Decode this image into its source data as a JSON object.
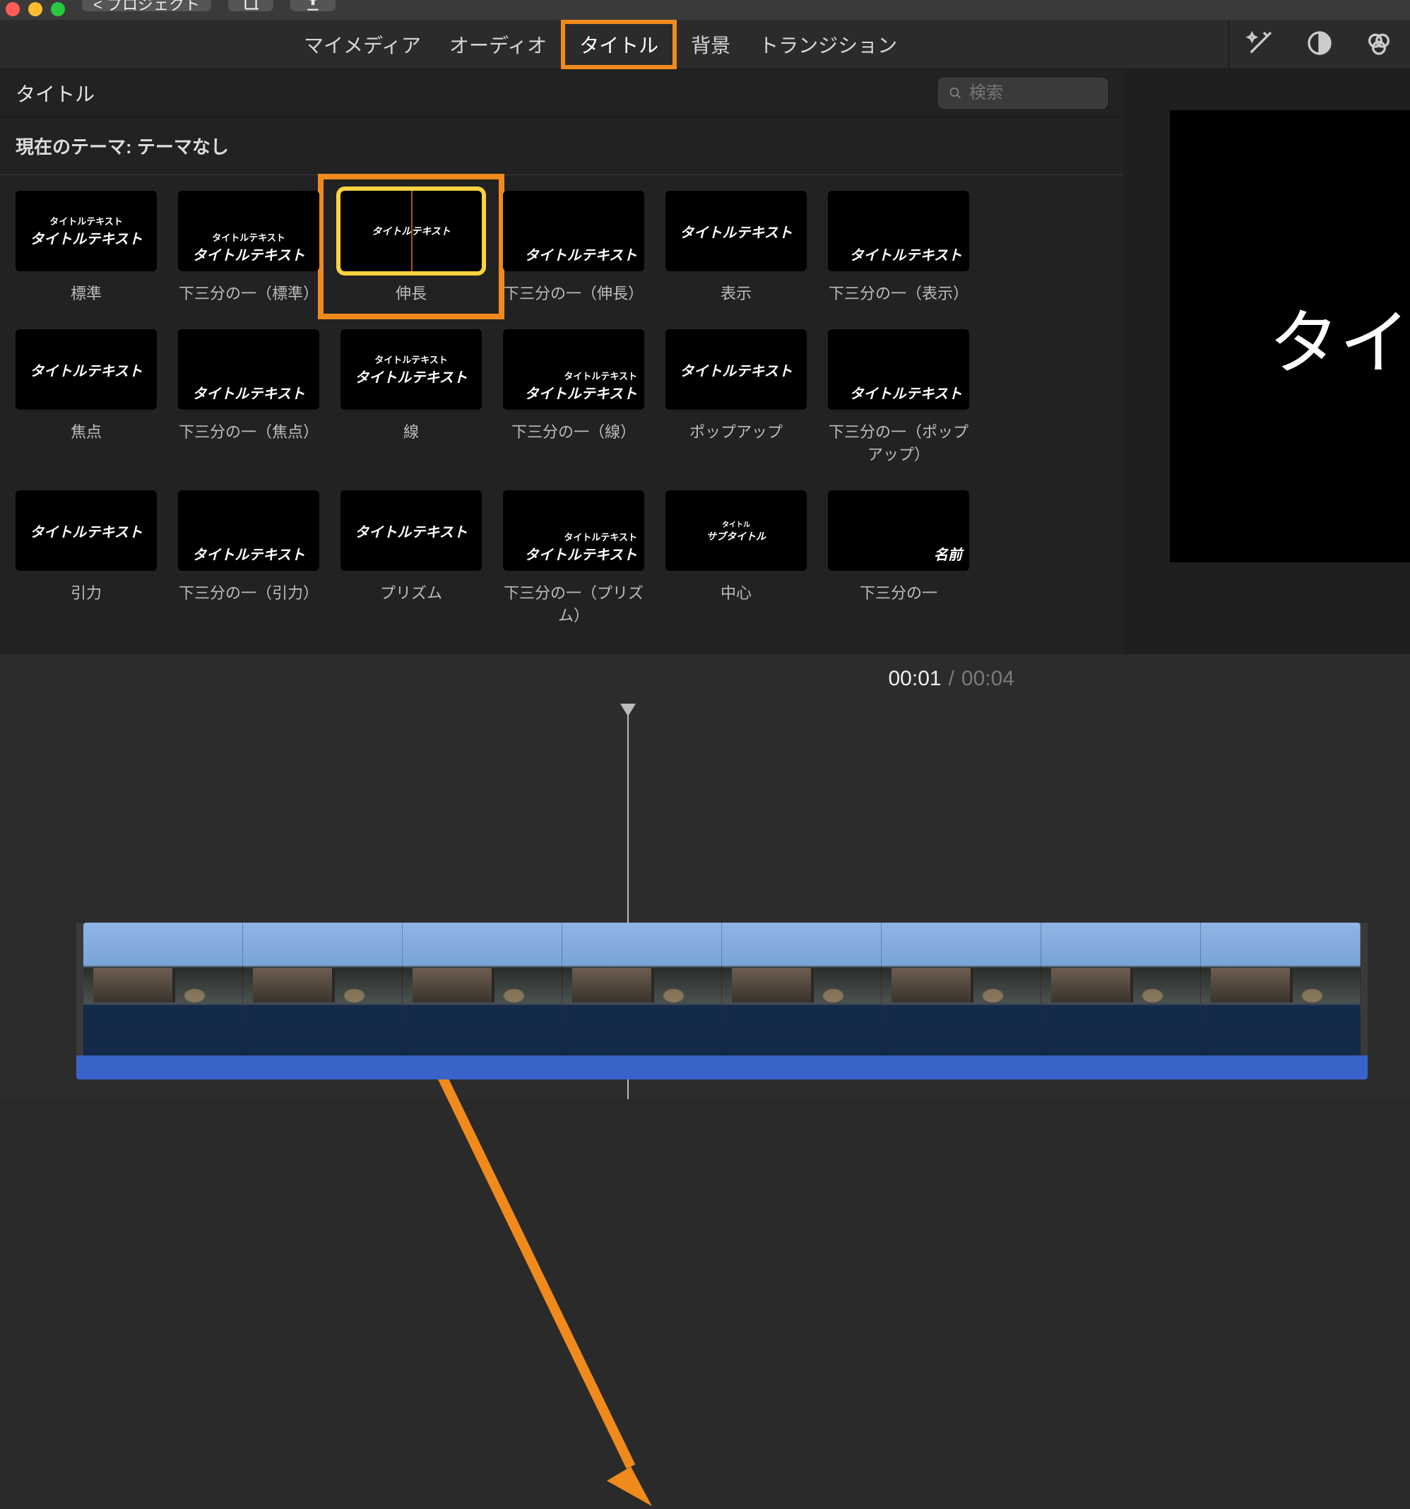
{
  "toolbar": {
    "project_button": "< プロジェクト"
  },
  "tabs": {
    "my_media": "マイメディア",
    "audio": "オーディオ",
    "titles": "タイトル",
    "backgrounds": "背景",
    "transitions": "トランジション"
  },
  "section_title": "タイトル",
  "search_placeholder": "検索",
  "theme_label": "現在のテーマ: テーマなし",
  "preview_word": "タイ",
  "time": {
    "current": "00:01",
    "total": "00:04"
  },
  "tiles": [
    {
      "label": "標準",
      "l1": "タイトルテキスト",
      "l2": "タイトルテキスト",
      "style": "center"
    },
    {
      "label": "下三分の一（標準）",
      "l1": "タイトルテキスト",
      "l2": "タイトルテキスト",
      "style": "lower"
    },
    {
      "label": "伸長",
      "l1": "",
      "l2": "タイトルテキスト",
      "style": "center-sm",
      "sel": true
    },
    {
      "label": "下三分の一（伸長）",
      "l1": "",
      "l2": "タイトルテキスト",
      "style": "lower-right"
    },
    {
      "label": "表示",
      "l1": "",
      "l2": "タイトルテキスト",
      "style": "center"
    },
    {
      "label": "下三分の一（表示）",
      "l1": "",
      "l2": "タイトルテキスト",
      "style": "lower-right"
    },
    {
      "label": "焦点",
      "l1": "",
      "l2": "タイトルテキスト",
      "style": "center"
    },
    {
      "label": "下三分の一（焦点）",
      "l1": "",
      "l2": "タイトルテキスト",
      "style": "lower"
    },
    {
      "label": "線",
      "l1": "タイトルテキスト",
      "l2": "タイトルテキスト",
      "style": "center"
    },
    {
      "label": "下三分の一（線）",
      "l1": "タイトルテキスト",
      "l2": "タイトルテキスト",
      "style": "lower-right"
    },
    {
      "label": "ポップアップ",
      "l1": "",
      "l2": "タイトルテキスト",
      "style": "center"
    },
    {
      "label": "下三分の一（ポップアップ）",
      "l1": "",
      "l2": "タイトルテキスト",
      "style": "lower-right"
    },
    {
      "label": "引力",
      "l1": "",
      "l2": "タイトルテキスト",
      "style": "center"
    },
    {
      "label": "下三分の一（引力）",
      "l1": "",
      "l2": "タイトルテキスト",
      "style": "lower"
    },
    {
      "label": "プリズム",
      "l1": "",
      "l2": "タイトルテキスト",
      "style": "center"
    },
    {
      "label": "下三分の一（プリズム）",
      "l1": "タイトルテキスト",
      "l2": "タイトルテキスト",
      "style": "lower-right"
    },
    {
      "label": "中心",
      "l1": "タイトル",
      "l2": "サブタイトル",
      "style": "center-sm"
    },
    {
      "label": "下三分の一",
      "l1": "",
      "l2": "名前",
      "style": "lower-right"
    }
  ]
}
